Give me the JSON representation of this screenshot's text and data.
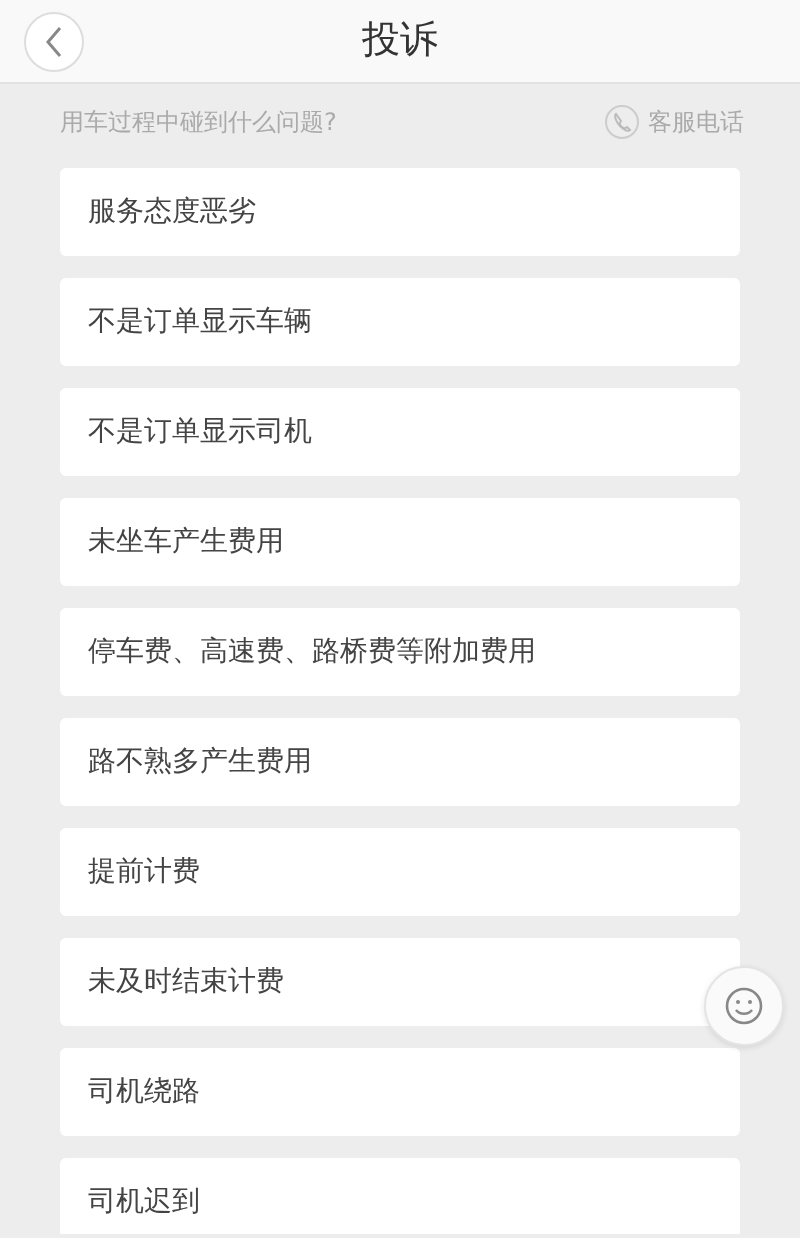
{
  "header": {
    "title": "投诉"
  },
  "prompt": {
    "question": "用车过程中碰到什么问题?",
    "service_phone": "客服电话"
  },
  "issues": [
    {
      "label": "服务态度恶劣"
    },
    {
      "label": "不是订单显示车辆"
    },
    {
      "label": "不是订单显示司机"
    },
    {
      "label": "未坐车产生费用"
    },
    {
      "label": "停车费、高速费、路桥费等附加费用"
    },
    {
      "label": "路不熟多产生费用"
    },
    {
      "label": "提前计费"
    },
    {
      "label": "未及时结束计费"
    },
    {
      "label": "司机绕路"
    },
    {
      "label": "司机迟到"
    }
  ]
}
